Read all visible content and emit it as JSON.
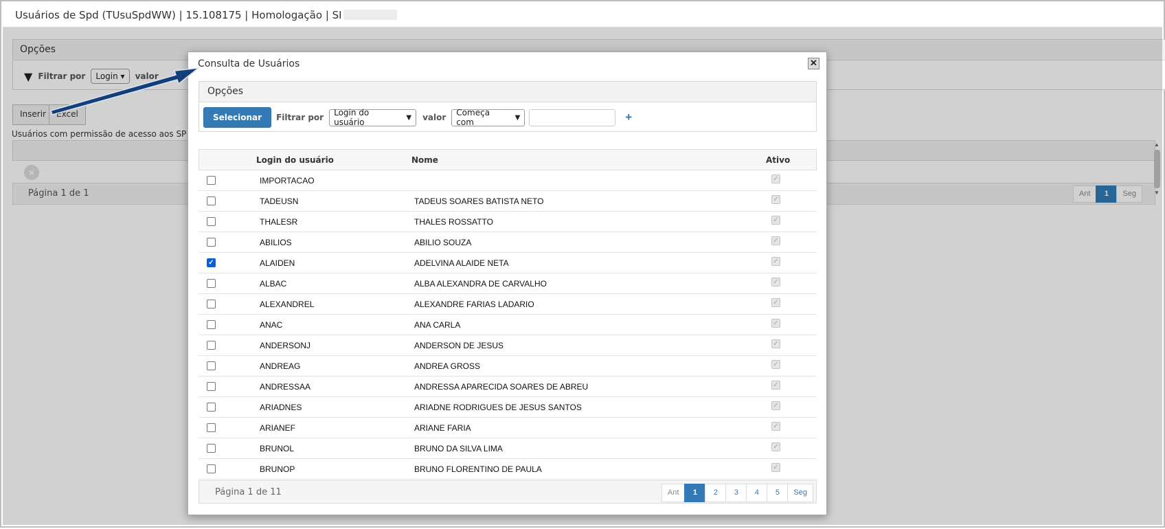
{
  "window": {
    "title": "Usuários de Spd (TUsuSpdWW) | 15.108175 | Homologação | SI"
  },
  "background": {
    "options_title": "Opções",
    "filter_label": "Filtrar por",
    "filter_select": "Login",
    "value_label": "valor",
    "insert_button": "Inserir",
    "excel_button": "Excel",
    "description": "Usuários com permissão de acesso aos SP",
    "pager_text": "Página 1 de 1",
    "pages": [
      "Ant",
      "1",
      "Seg"
    ]
  },
  "modal": {
    "title": "Consulta de Usuários",
    "close_label": "✕",
    "options_title": "Opções",
    "select_button": "Selecionar",
    "filter_label": "Filtrar por",
    "filter_select": "Login do usuário",
    "value_label": "valor",
    "operator_select": "Começa com",
    "value_input": "",
    "add_label": "+",
    "columns": {
      "login": "Login do usuário",
      "nome": "Nome",
      "ativo": "Ativo"
    },
    "rows": [
      {
        "login": "IMPORTACAO",
        "nome": "",
        "selected": false,
        "ativo": true
      },
      {
        "login": "TADEUSN",
        "nome": "TADEUS SOARES BATISTA NETO",
        "selected": false,
        "ativo": true
      },
      {
        "login": "THALESR",
        "nome": "THALES ROSSATTO",
        "selected": false,
        "ativo": true
      },
      {
        "login": "ABILIOS",
        "nome": "ABILIO SOUZA",
        "selected": false,
        "ativo": true
      },
      {
        "login": "ALAIDEN",
        "nome": "ADELVINA ALAIDE NETA",
        "selected": true,
        "ativo": true
      },
      {
        "login": "ALBAC",
        "nome": "ALBA ALEXANDRA DE CARVALHO",
        "selected": false,
        "ativo": true
      },
      {
        "login": "ALEXANDREL",
        "nome": "ALEXANDRE FARIAS LADARIO",
        "selected": false,
        "ativo": true
      },
      {
        "login": "ANAC",
        "nome": "ANA CARLA",
        "selected": false,
        "ativo": true
      },
      {
        "login": "ANDERSONJ",
        "nome": "ANDERSON DE JESUS",
        "selected": false,
        "ativo": true
      },
      {
        "login": "ANDREAG",
        "nome": "ANDREA GROSS",
        "selected": false,
        "ativo": true
      },
      {
        "login": "ANDRESSAA",
        "nome": "ANDRESSA APARECIDA SOARES DE ABREU",
        "selected": false,
        "ativo": true
      },
      {
        "login": "ARIADNES",
        "nome": "ARIADNE RODRIGUES DE JESUS SANTOS",
        "selected": false,
        "ativo": true
      },
      {
        "login": "ARIANEF",
        "nome": "ARIANE FARIA",
        "selected": false,
        "ativo": true
      },
      {
        "login": "BRUNOL",
        "nome": "BRUNO DA SILVA LIMA",
        "selected": false,
        "ativo": true
      },
      {
        "login": "BRUNOP",
        "nome": "BRUNO FLORENTINO DE PAULA",
        "selected": false,
        "ativo": true
      }
    ],
    "pager_text": "Página 1 de 11",
    "pages": [
      "Ant",
      "1",
      "2",
      "3",
      "4",
      "5",
      "Seg"
    ]
  },
  "colors": {
    "primary": "#337ab7",
    "arrow": "#123f78"
  }
}
